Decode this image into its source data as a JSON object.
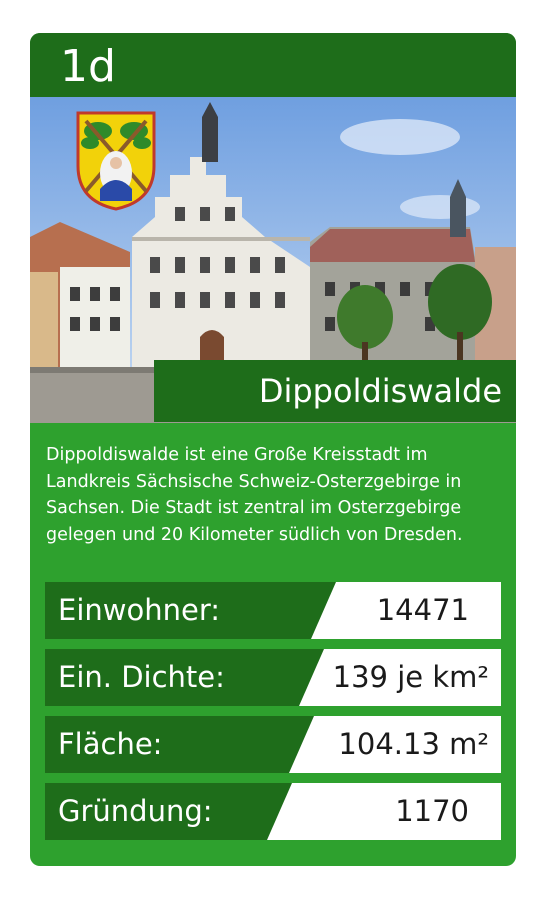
{
  "card": {
    "id": "1d",
    "city_name": "Dippoldiswalde",
    "description": "Dippoldiswalde ist eine Große Kreisstadt im Landkreis Sächsische Schweiz-Osterzgebirge in Sachsen. Die Stadt ist zentral im Osterzgebirge gelegen und 20 Kilometer südlich von Dresden.",
    "photo_subject": "town-square-photo",
    "coat_of_arms": "coat-of-arms-icon"
  },
  "stats": [
    {
      "label": "Einwohner:",
      "value": "14471"
    },
    {
      "label": "Ein. Dichte:",
      "value": "139 je km²"
    },
    {
      "label": "Fläche:",
      "value": "104.13 m²"
    },
    {
      "label": "Gründung:",
      "value": "1170"
    }
  ],
  "colors": {
    "card_green": "#2ea12e",
    "dark_green": "#1e6d1a",
    "value_bg": "#ffffff"
  }
}
